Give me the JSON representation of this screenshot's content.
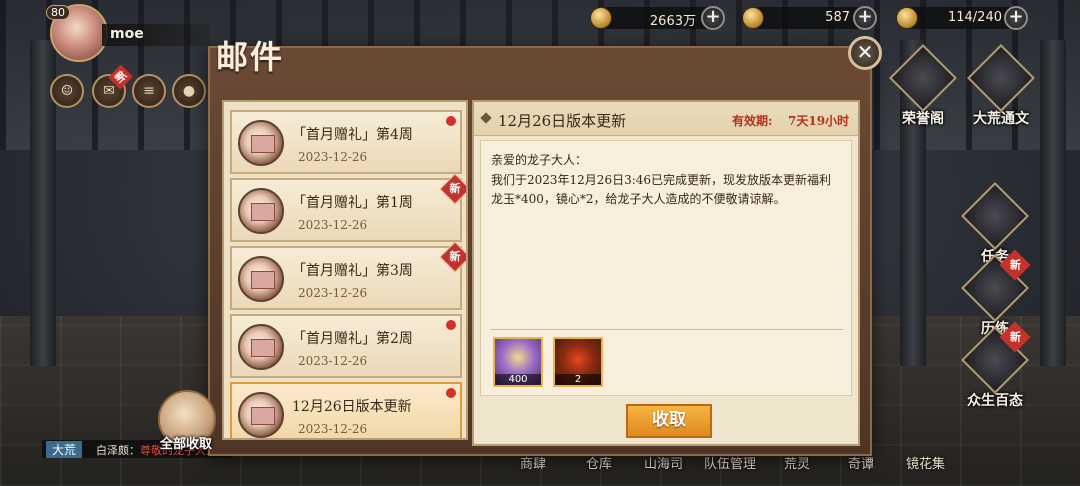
{
  "player": {
    "level": "80",
    "name": "moe"
  },
  "hud": {
    "new_badge": "新",
    "currencies": [
      {
        "icon": "coin-icon",
        "value": "2663万"
      },
      {
        "icon": "jade-icon",
        "value": "587"
      },
      {
        "icon": "stamina-icon",
        "value": "114/240"
      }
    ]
  },
  "side_menu": [
    {
      "label": "荣誉阁"
    },
    {
      "label": "大荒通文"
    },
    {
      "label": "任务"
    },
    {
      "label": "历练"
    },
    {
      "label": "众生百态"
    }
  ],
  "side_new": "新",
  "bottom_nav": [
    "商肆",
    "仓库",
    "山海司",
    "队伍管理",
    "荒灵",
    "奇谭",
    "镜花集"
  ],
  "chat": {
    "channel": "大荒",
    "sender": "白泽颇：",
    "message": "尊敬的龙子大人"
  },
  "collect_all_label": "全部收取",
  "mail": {
    "title": "邮件",
    "close": "✕",
    "items": [
      {
        "title": "「首月赠礼」第4周",
        "date": "2023-12-26",
        "marker": "dot"
      },
      {
        "title": "「首月赠礼」第1周",
        "date": "2023-12-26",
        "marker": "new"
      },
      {
        "title": "「首月赠礼」第3周",
        "date": "2023-12-26",
        "marker": "new"
      },
      {
        "title": "「首月赠礼」第2周",
        "date": "2023-12-26",
        "marker": "dot"
      },
      {
        "title": "12月26日版本更新",
        "date": "2023-12-26",
        "marker": "dot",
        "selected": true
      }
    ],
    "new_tag": "新",
    "detail": {
      "title": "12月26日版本更新",
      "expiry_label": "有效期:",
      "expiry_value": "7天19小时",
      "greeting": "亲爱的龙子大人：",
      "text": "我们于2023年12月26日3:46已完成更新，现发放版本更新福利龙玉*400，镜心*2，给龙子大人造成的不便敬请谅解。",
      "rewards": [
        {
          "icon": "dragon-jade-icon",
          "count": "400"
        },
        {
          "icon": "mirror-heart-icon",
          "count": "2"
        }
      ],
      "claim_label": "收取"
    }
  }
}
